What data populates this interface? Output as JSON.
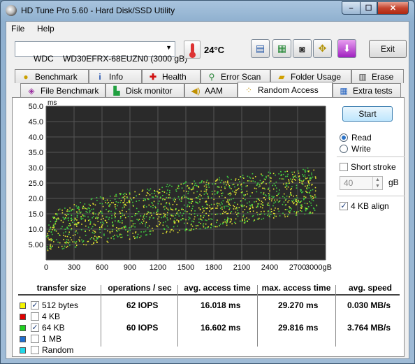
{
  "window": {
    "title": "HD Tune Pro 5.60 - Hard Disk/SSD Utility",
    "min_glyph": "–",
    "max_glyph": "☐",
    "close_glyph": "✕"
  },
  "menu": {
    "file": "File",
    "help": "Help"
  },
  "toolbar": {
    "drive": "WDC    WD30EFRX-68EUZN0 (3000 gB)",
    "temperature": "24°C",
    "exit_label": "Exit",
    "icons": [
      "copy-info-icon",
      "copy-screenshot-icon",
      "camera-icon",
      "options-icon",
      "save-icon"
    ]
  },
  "tabs_row1": [
    {
      "label": "Benchmark",
      "icon": "benchmark-icon"
    },
    {
      "label": "Info",
      "icon": "info-icon"
    },
    {
      "label": "Health",
      "icon": "health-icon"
    },
    {
      "label": "Error Scan",
      "icon": "error-scan-icon"
    },
    {
      "label": "Folder Usage",
      "icon": "folder-icon"
    },
    {
      "label": "Erase",
      "icon": "erase-icon"
    }
  ],
  "tabs_row2": [
    {
      "label": "File Benchmark",
      "icon": "file-benchmark-icon"
    },
    {
      "label": "Disk monitor",
      "icon": "disk-monitor-icon"
    },
    {
      "label": "AAM",
      "icon": "speaker-icon"
    },
    {
      "label": "Random Access",
      "icon": "random-access-icon",
      "active": true
    },
    {
      "label": "Extra tests",
      "icon": "extra-tests-icon"
    }
  ],
  "side": {
    "start_label": "Start",
    "read_label": "Read",
    "write_label": "Write",
    "mode": "Read",
    "short_stroke_label": "Short stroke",
    "short_stroke_checked": false,
    "stroke_value": "40",
    "gb_label": "gB",
    "align_label": "4 KB align",
    "align_checked": true
  },
  "results": {
    "headers": [
      "transfer size",
      "operations / sec",
      "avg. access time",
      "max. access time",
      "avg. speed"
    ],
    "rows": [
      {
        "label": "512 bytes",
        "color": "#f5f500",
        "checked": true,
        "ops": "62 IOPS",
        "avg": "16.018 ms",
        "max": "29.270 ms",
        "speed": "0.030 MB/s"
      },
      {
        "label": "4 KB",
        "color": "#e00000",
        "checked": false,
        "ops": "",
        "avg": "",
        "max": "",
        "speed": ""
      },
      {
        "label": "64 KB",
        "color": "#20d020",
        "checked": true,
        "ops": "60 IOPS",
        "avg": "16.602 ms",
        "max": "29.816 ms",
        "speed": "3.764 MB/s"
      },
      {
        "label": "1 MB",
        "color": "#1f6fd0",
        "checked": false,
        "ops": "",
        "avg": "",
        "max": "",
        "speed": ""
      },
      {
        "label": "Random",
        "color": "#20d8e8",
        "checked": false,
        "ops": "",
        "avg": "",
        "max": "",
        "speed": ""
      }
    ]
  },
  "chart_data": {
    "type": "scatter",
    "ylabel": "ms",
    "xunit": "gB",
    "yticks": [
      "50.0",
      "45.0",
      "40.0",
      "35.0",
      "30.0",
      "25.0",
      "20.0",
      "15.0",
      "10.0",
      "5.00"
    ],
    "xticks": [
      "0",
      "300",
      "600",
      "900",
      "1200",
      "1500",
      "1800",
      "2100",
      "2400",
      "2700",
      "3000gB"
    ],
    "xlim": [
      0,
      3000
    ],
    "ylim": [
      0,
      50
    ],
    "grid": true,
    "background": "#2a2a2a",
    "series": [
      {
        "name": "512 bytes",
        "color": "#e8e830",
        "avg_ms": 16.018,
        "max_ms": 29.27,
        "min_ms": 3.0
      },
      {
        "name": "64 KB",
        "color": "#40d040",
        "avg_ms": 16.602,
        "max_ms": 29.816,
        "min_ms": 3.0
      }
    ]
  }
}
